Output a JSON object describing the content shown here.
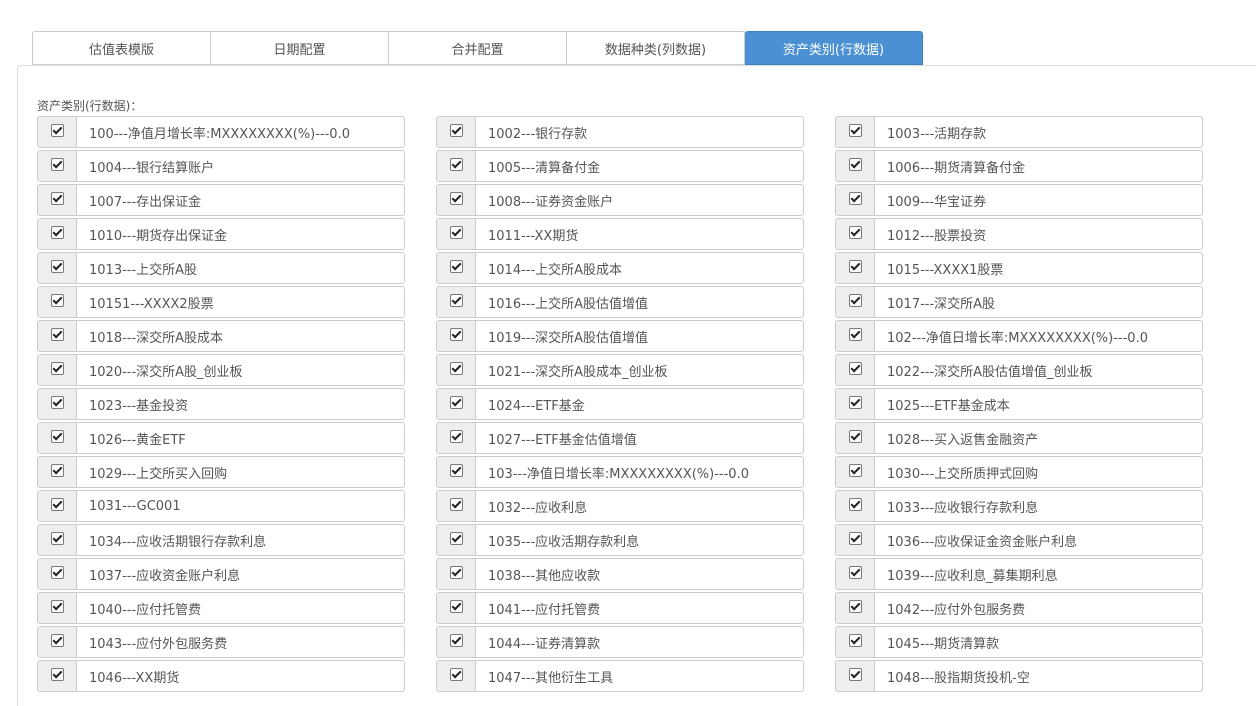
{
  "tabs": [
    {
      "label": "估值表模版",
      "active": false
    },
    {
      "label": "日期配置",
      "active": false
    },
    {
      "label": "合并配置",
      "active": false
    },
    {
      "label": "数据种类(列数据)",
      "active": false
    },
    {
      "label": "资产类别(行数据)",
      "active": true
    }
  ],
  "section_label": "资产类别(行数据)：",
  "items": [
    {
      "label": "100---净值月增长率:MXXXXXXXX(%)---0.0",
      "checked": true
    },
    {
      "label": "1002---银行存款",
      "checked": true
    },
    {
      "label": "1003---活期存款",
      "checked": true
    },
    {
      "label": "1004---银行结算账户",
      "checked": true
    },
    {
      "label": "1005---清算备付金",
      "checked": true
    },
    {
      "label": "1006---期货清算备付金",
      "checked": true
    },
    {
      "label": "1007---存出保证金",
      "checked": true
    },
    {
      "label": "1008---证券资金账户",
      "checked": true
    },
    {
      "label": "1009---华宝证券",
      "checked": true
    },
    {
      "label": "1010---期货存出保证金",
      "checked": true
    },
    {
      "label": "1011---XX期货",
      "checked": true
    },
    {
      "label": "1012---股票投资",
      "checked": true
    },
    {
      "label": "1013---上交所A股",
      "checked": true
    },
    {
      "label": "1014---上交所A股成本",
      "checked": true
    },
    {
      "label": "1015---XXXX1股票",
      "checked": true
    },
    {
      "label": "10151---XXXX2股票",
      "checked": true
    },
    {
      "label": "1016---上交所A股估值增值",
      "checked": true
    },
    {
      "label": "1017---深交所A股",
      "checked": true
    },
    {
      "label": "1018---深交所A股成本",
      "checked": true
    },
    {
      "label": "1019---深交所A股估值增值",
      "checked": true
    },
    {
      "label": "102---净值日增长率:MXXXXXXXX(%)---0.0",
      "checked": true
    },
    {
      "label": "1020---深交所A股_创业板",
      "checked": true
    },
    {
      "label": "1021---深交所A股成本_创业板",
      "checked": true
    },
    {
      "label": "1022---深交所A股估值增值_创业板",
      "checked": true
    },
    {
      "label": "1023---基金投资",
      "checked": true
    },
    {
      "label": "1024---ETF基金",
      "checked": true
    },
    {
      "label": "1025---ETF基金成本",
      "checked": true
    },
    {
      "label": "1026---黄金ETF",
      "checked": true
    },
    {
      "label": "1027---ETF基金估值增值",
      "checked": true
    },
    {
      "label": "1028---买入返售金融资产",
      "checked": true
    },
    {
      "label": "1029---上交所买入回购",
      "checked": true
    },
    {
      "label": "103---净值日增长率:MXXXXXXXX(%)---0.0",
      "checked": true
    },
    {
      "label": "1030---上交所质押式回购",
      "checked": true
    },
    {
      "label": "1031---GC001",
      "checked": true
    },
    {
      "label": "1032---应收利息",
      "checked": true
    },
    {
      "label": "1033---应收银行存款利息",
      "checked": true
    },
    {
      "label": "1034---应收活期银行存款利息",
      "checked": true
    },
    {
      "label": "1035---应收活期存款利息",
      "checked": true
    },
    {
      "label": "1036---应收保证金资金账户利息",
      "checked": true
    },
    {
      "label": "1037---应收资金账户利息",
      "checked": true
    },
    {
      "label": "1038---其他应收款",
      "checked": true
    },
    {
      "label": "1039---应收利息_募集期利息",
      "checked": true
    },
    {
      "label": "1040---应付托管费",
      "checked": true
    },
    {
      "label": "1041---应付托管费",
      "checked": true
    },
    {
      "label": "1042---应付外包服务费",
      "checked": true
    },
    {
      "label": "1043---应付外包服务费",
      "checked": true
    },
    {
      "label": "1044---证券清算款",
      "checked": true
    },
    {
      "label": "1045---期货清算款",
      "checked": true
    },
    {
      "label": "1046---XX期货",
      "checked": true
    },
    {
      "label": "1047---其他衍生工具",
      "checked": true
    },
    {
      "label": "1048---股指期货投机-空",
      "checked": true
    }
  ]
}
